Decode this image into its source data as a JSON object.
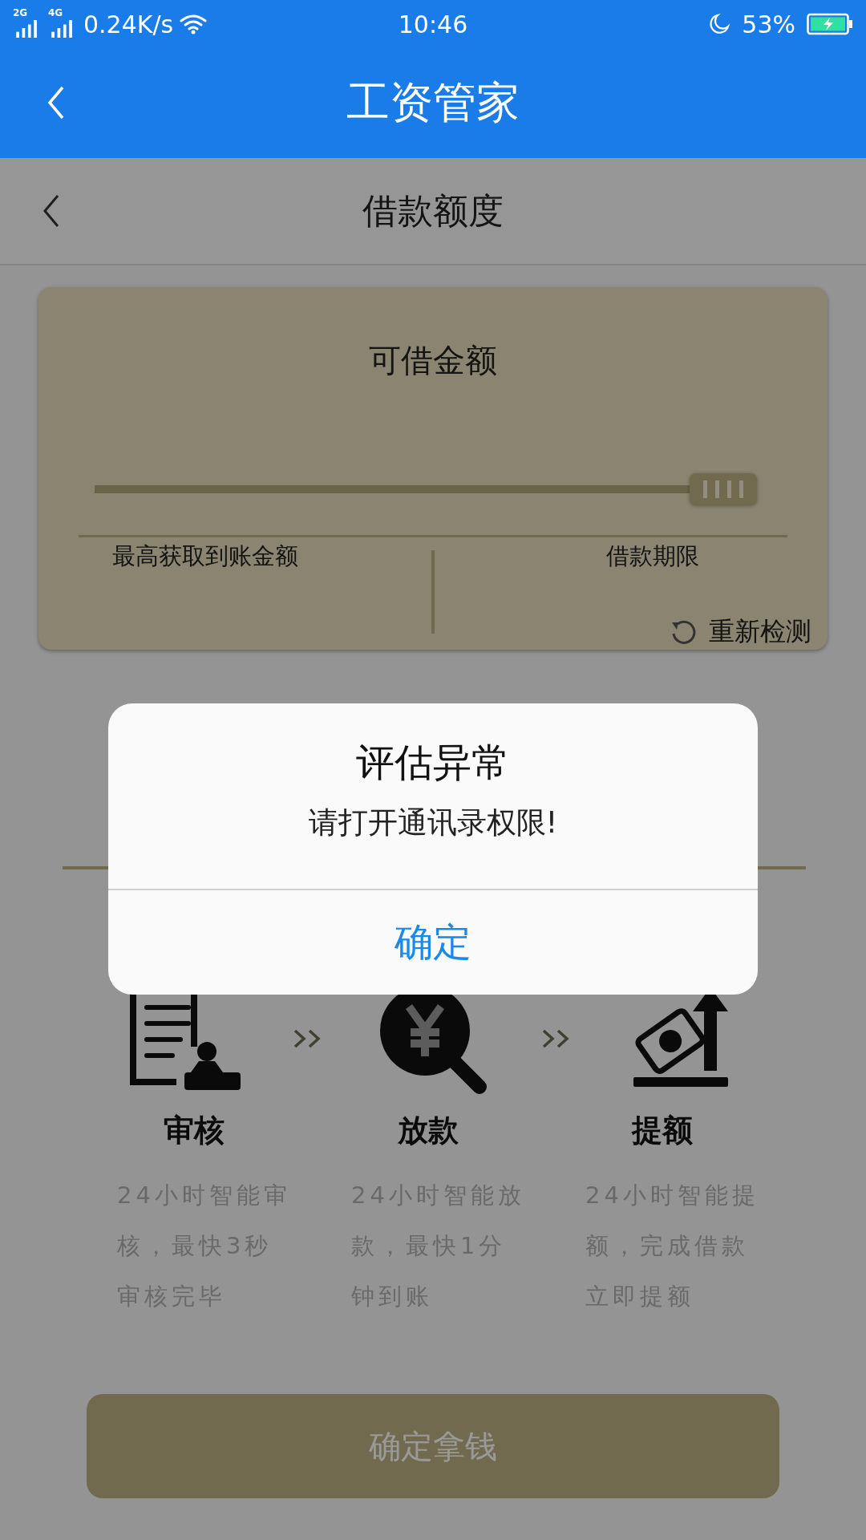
{
  "status_bar": {
    "signal_1": "2G",
    "signal_2": "4G",
    "speed": "0.24K/s",
    "time": "10:46",
    "battery": "53%"
  },
  "header": {
    "title": "工资管家"
  },
  "sub_header": {
    "title": "借款额度"
  },
  "card": {
    "title": "可借金额",
    "slider": {
      "level": 1
    },
    "label_left": "最高获取到账金额",
    "label_right": "借款期限",
    "refresh": "重新检测"
  },
  "steps": [
    {
      "title": "审核",
      "description": "24小时智能审核，最快3秒审核完毕",
      "kind": "document"
    },
    {
      "title": "放款",
      "description": "24小时智能放款，最快1分钟到账",
      "kind": "search"
    },
    {
      "title": "提额",
      "description": "24小时智能提额，完成借款立即提额",
      "kind": "raise"
    }
  ],
  "submit_button": "确定拿钱",
  "dialog": {
    "title": "评估异常",
    "message": "请打开通讯录权限!",
    "button": "确定"
  }
}
